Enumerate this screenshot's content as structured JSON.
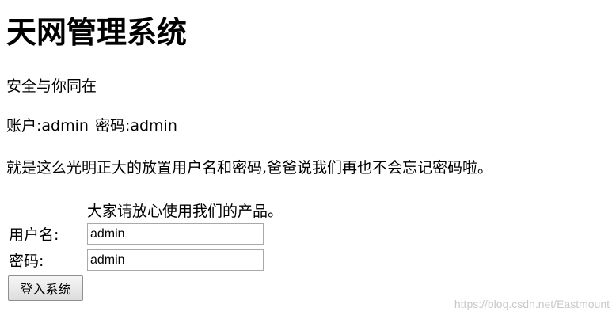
{
  "page": {
    "title": "天网管理系统",
    "tagline": "安全与你同在",
    "account_label": "账户:admin",
    "password_label": "密码:admin",
    "notice": "就是这么光明正大的放置用户名和密码,爸爸说我们再也不会忘记密码啦。",
    "reassurance": "大家请放心使用我们的产品。"
  },
  "form": {
    "username_label": "用户名:",
    "username_value": "admin",
    "password_label": "密码:",
    "password_value": "admin",
    "submit_label": "登入系统"
  },
  "watermark": "https://blog.csdn.net/Eastmount"
}
